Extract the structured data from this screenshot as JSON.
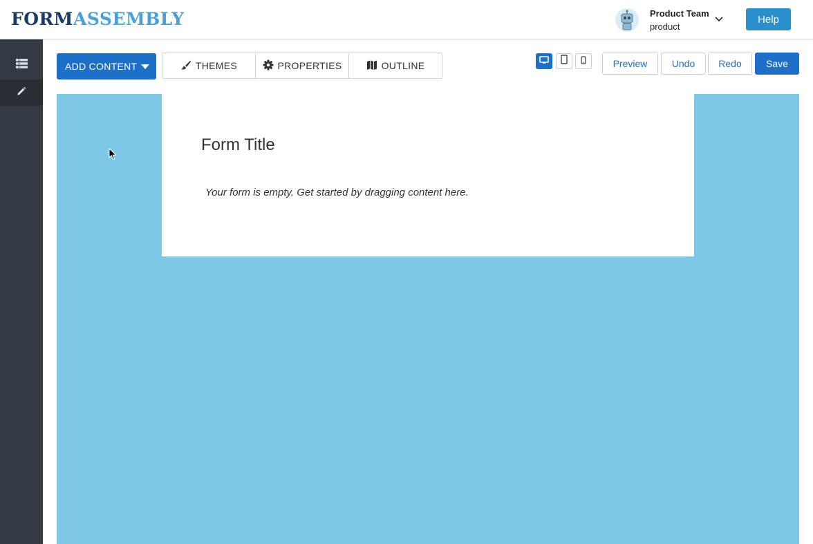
{
  "header": {
    "logo_part1": "FORM",
    "logo_part2": "ASSEMBLY",
    "user_name": "Product Team",
    "user_sub": "product",
    "help_label": "Help"
  },
  "sidebar": {
    "items": [
      {
        "icon": "list-icon"
      },
      {
        "icon": "pencil-icon",
        "active": true
      }
    ]
  },
  "toolbar": {
    "add_content_label": "ADD CONTENT",
    "tabs": [
      {
        "label": "THEMES",
        "icon": "brush-icon"
      },
      {
        "label": "PROPERTIES",
        "icon": "gear-icon"
      },
      {
        "label": "OUTLINE",
        "icon": "map-icon"
      }
    ],
    "devices": [
      "desktop-icon",
      "tablet-icon",
      "phone-icon"
    ],
    "preview_label": "Preview",
    "undo_label": "Undo",
    "redo_label": "Redo",
    "save_label": "Save"
  },
  "form": {
    "title": "Form Title",
    "empty_message": "Your form is empty. Get started by dragging content here."
  },
  "colors": {
    "accent": "#1e6fc8",
    "canvas": "#7ec8e7",
    "sidebar": "#333a44",
    "logo_dark": "#1b3a63",
    "logo_light": "#4a9fd4"
  }
}
